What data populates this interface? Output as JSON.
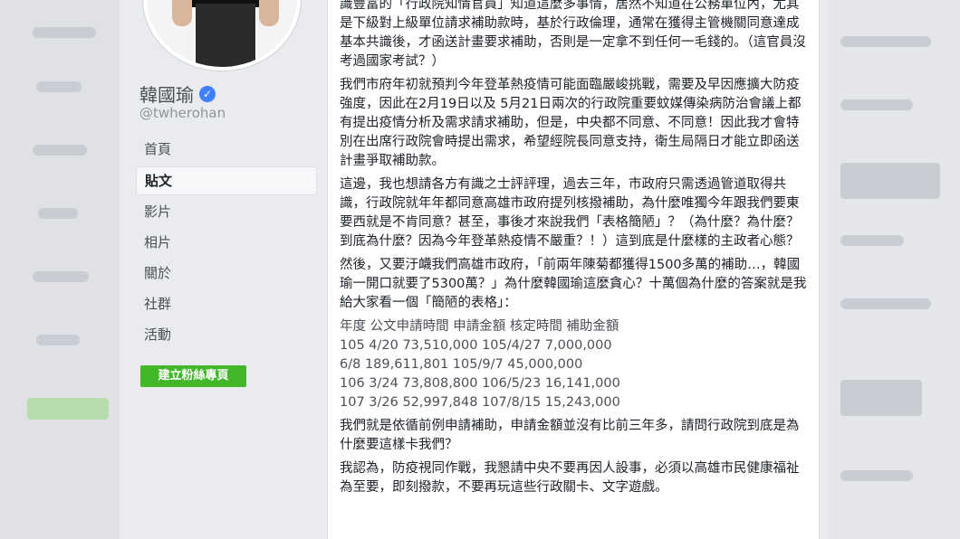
{
  "profile": {
    "name": "韓國瑜",
    "handle": "@twherohan"
  },
  "nav": {
    "items": [
      "首頁",
      "貼文",
      "影片",
      "相片",
      "關於",
      "社群",
      "活動"
    ],
    "active": "貼文"
  },
  "create_button": "建立粉絲專頁",
  "post": {
    "paragraphs": [
      "識豐富的「行政院知情官員」知道這麼多事情，居然不知道在公務單位內，尤其是下級對上級單位請求補助款時，基於行政倫理，通常在獲得主管機關同意達成基本共識後，才函送計畫要求補助，否則是一定拿不到任何一毛錢的。（這官員沒考過國家考試？）",
      "我們市府年初就預判今年登革熱疫情可能面臨嚴峻挑戰，需要及早因應擴大防疫強度，因此在2月19日以及 5月21日兩次的行政院重要蚊媒傳染病防治會議上都有提出疫情分析及需求請求補助，但是，中央都不同意、不同意！因此我才會特別在出席行政院會時提出需求，希望經院長同意支持，衛生局隔日才能立即函送計畫爭取補助款。",
      "這邊，我也想請各方有識之士評評理，過去三年，市政府只需透過管道取得共識，行政院就年年都同意高雄市政府提列核撥補助，為什麼唯獨今年跟我們要東要西就是不肯同意？甚至，事後才來說我們「表格簡陋」？（為什麼？為什麼？到底為什麼？因為今年登革熱疫情不嚴重？！）這到底是什麼樣的主政者心態？",
      "然後，又要汙衊我們高雄市政府，「前兩年陳菊都獲得1500多萬的補助…，韓國瑜一開口就要了5300萬？」為什麼韓國瑜這麼貪心？十萬個為什麼的答案就是我給大家看一個「簡陋的表格」："
    ],
    "table_lines": [
      "年度 公文申請時間 申請金額 核定時間 補助金額",
      "105 4/20 73,510,000 105/4/27 7,000,000",
      "6/8 189,611,801 105/9/7 45,000,000",
      "106 3/24 73,808,800 106/5/23 16,141,000",
      "107 3/26 52,997,848 107/8/15 15,243,000"
    ],
    "closing_paragraphs": [
      "我們就是依循前例申請補助，申請金額並沒有比前三年多，請問行政院到底是為什麼要這樣卡我們？",
      "我認為，防疫視同作戰，我懇請中央不要再因人設事，必須以高雄市民健康福祉為至要，即刻撥款，不要再玩這些行政關卡、文字遊戲。"
    ]
  },
  "colors": {
    "verified": "#4080ff",
    "create_button": "#42b72a",
    "background": "#e9ebee"
  },
  "icons": [
    "verified-badge-icon"
  ]
}
